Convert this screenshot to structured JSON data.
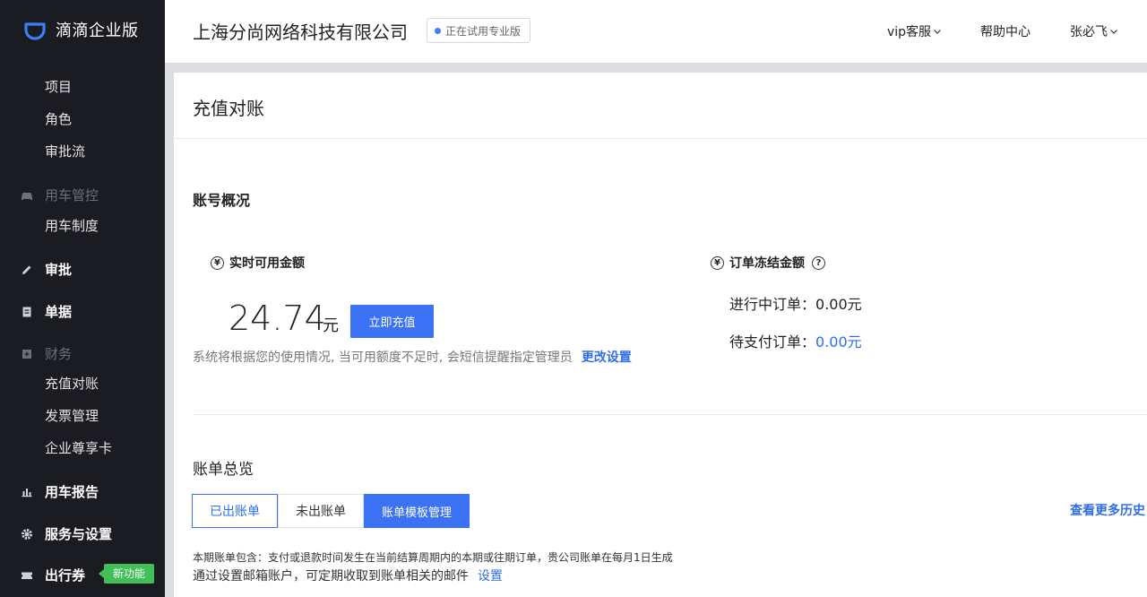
{
  "app": {
    "logo_text": "滴滴企业版"
  },
  "sidebar": {
    "sub_items_top": [
      "项目",
      "角色",
      "审批流"
    ],
    "car_control_group": "用车管控",
    "car_policy": "用车制度",
    "approval": "审批",
    "documents": "单据",
    "finance_group": "财务",
    "finance_items": [
      "充值对账",
      "发票管理",
      "企业尊享卡"
    ],
    "report": "用车报告",
    "service_settings": "服务与设置",
    "travel_voucher": "出行券",
    "new_feature_badge": "新功能"
  },
  "header": {
    "company_name": "上海分尚网络科技有限公司",
    "trial_badge": "正在试用专业版",
    "vip_service": "vip客服",
    "help_center": "帮助中心",
    "user_name": "张必飞"
  },
  "page": {
    "title": "充值对账",
    "account_overview_title": "账号概况",
    "available_label": "实时可用金额",
    "available_amount": "24.74",
    "amount_unit": "元",
    "recharge_button": "立即充值",
    "notice_text": "系统将根据您的使用情况, 当可用额度不足时, 会短信提醒指定管理员",
    "change_settings": "更改设置",
    "frozen_label": "订单冻结金额",
    "in_progress_label": "进行中订单：",
    "in_progress_value": "0.00元",
    "pending_pay_label": "待支付订单：",
    "pending_pay_value": "0.00元",
    "bill_overview_title": "账单总览",
    "tabs": [
      "已出账单",
      "未出账单",
      "账单模板管理"
    ],
    "history_link": "查看更多历史",
    "bill_note": "本期账单包含：支付或退款时间发生在当前结算周期内的本期或往期订单，贵公司账单在每月1日生成",
    "email_note": "通过设置邮箱账户，可定期收取到账单相关的邮件",
    "email_settings": "设置"
  },
  "colors": {
    "sidebar_bg": "#1b1c22",
    "primary": "#3b72f6",
    "link": "#2f6ee8",
    "badge_green": "#40c057"
  }
}
